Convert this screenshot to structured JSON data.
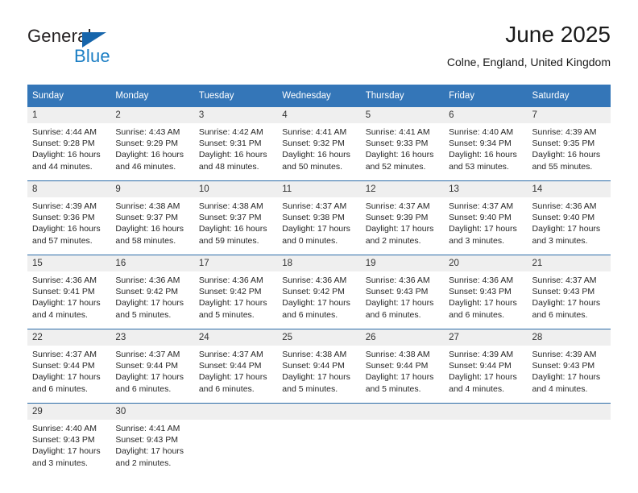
{
  "brand": {
    "name_part1": "General",
    "name_part2": "Blue",
    "triangle_icon": "blue-triangle-icon",
    "accent_color": "#1665ab",
    "blue_text_color": "#1b7ec4"
  },
  "header": {
    "title": "June 2025",
    "subtitle": "Colne, England, United Kingdom"
  },
  "calendar": {
    "header_bg": "#3476b8",
    "daynum_bg": "#efefef",
    "rule_color": "#2c6ca8",
    "weekday_headers": [
      "Sunday",
      "Monday",
      "Tuesday",
      "Wednesday",
      "Thursday",
      "Friday",
      "Saturday"
    ],
    "weeks": [
      [
        {
          "day": "1",
          "sunrise": "Sunrise: 4:44 AM",
          "sunset": "Sunset: 9:28 PM",
          "daylight1": "Daylight: 16 hours",
          "daylight2": "and 44 minutes."
        },
        {
          "day": "2",
          "sunrise": "Sunrise: 4:43 AM",
          "sunset": "Sunset: 9:29 PM",
          "daylight1": "Daylight: 16 hours",
          "daylight2": "and 46 minutes."
        },
        {
          "day": "3",
          "sunrise": "Sunrise: 4:42 AM",
          "sunset": "Sunset: 9:31 PM",
          "daylight1": "Daylight: 16 hours",
          "daylight2": "and 48 minutes."
        },
        {
          "day": "4",
          "sunrise": "Sunrise: 4:41 AM",
          "sunset": "Sunset: 9:32 PM",
          "daylight1": "Daylight: 16 hours",
          "daylight2": "and 50 minutes."
        },
        {
          "day": "5",
          "sunrise": "Sunrise: 4:41 AM",
          "sunset": "Sunset: 9:33 PM",
          "daylight1": "Daylight: 16 hours",
          "daylight2": "and 52 minutes."
        },
        {
          "day": "6",
          "sunrise": "Sunrise: 4:40 AM",
          "sunset": "Sunset: 9:34 PM",
          "daylight1": "Daylight: 16 hours",
          "daylight2": "and 53 minutes."
        },
        {
          "day": "7",
          "sunrise": "Sunrise: 4:39 AM",
          "sunset": "Sunset: 9:35 PM",
          "daylight1": "Daylight: 16 hours",
          "daylight2": "and 55 minutes."
        }
      ],
      [
        {
          "day": "8",
          "sunrise": "Sunrise: 4:39 AM",
          "sunset": "Sunset: 9:36 PM",
          "daylight1": "Daylight: 16 hours",
          "daylight2": "and 57 minutes."
        },
        {
          "day": "9",
          "sunrise": "Sunrise: 4:38 AM",
          "sunset": "Sunset: 9:37 PM",
          "daylight1": "Daylight: 16 hours",
          "daylight2": "and 58 minutes."
        },
        {
          "day": "10",
          "sunrise": "Sunrise: 4:38 AM",
          "sunset": "Sunset: 9:37 PM",
          "daylight1": "Daylight: 16 hours",
          "daylight2": "and 59 minutes."
        },
        {
          "day": "11",
          "sunrise": "Sunrise: 4:37 AM",
          "sunset": "Sunset: 9:38 PM",
          "daylight1": "Daylight: 17 hours",
          "daylight2": "and 0 minutes."
        },
        {
          "day": "12",
          "sunrise": "Sunrise: 4:37 AM",
          "sunset": "Sunset: 9:39 PM",
          "daylight1": "Daylight: 17 hours",
          "daylight2": "and 2 minutes."
        },
        {
          "day": "13",
          "sunrise": "Sunrise: 4:37 AM",
          "sunset": "Sunset: 9:40 PM",
          "daylight1": "Daylight: 17 hours",
          "daylight2": "and 3 minutes."
        },
        {
          "day": "14",
          "sunrise": "Sunrise: 4:36 AM",
          "sunset": "Sunset: 9:40 PM",
          "daylight1": "Daylight: 17 hours",
          "daylight2": "and 3 minutes."
        }
      ],
      [
        {
          "day": "15",
          "sunrise": "Sunrise: 4:36 AM",
          "sunset": "Sunset: 9:41 PM",
          "daylight1": "Daylight: 17 hours",
          "daylight2": "and 4 minutes."
        },
        {
          "day": "16",
          "sunrise": "Sunrise: 4:36 AM",
          "sunset": "Sunset: 9:42 PM",
          "daylight1": "Daylight: 17 hours",
          "daylight2": "and 5 minutes."
        },
        {
          "day": "17",
          "sunrise": "Sunrise: 4:36 AM",
          "sunset": "Sunset: 9:42 PM",
          "daylight1": "Daylight: 17 hours",
          "daylight2": "and 5 minutes."
        },
        {
          "day": "18",
          "sunrise": "Sunrise: 4:36 AM",
          "sunset": "Sunset: 9:42 PM",
          "daylight1": "Daylight: 17 hours",
          "daylight2": "and 6 minutes."
        },
        {
          "day": "19",
          "sunrise": "Sunrise: 4:36 AM",
          "sunset": "Sunset: 9:43 PM",
          "daylight1": "Daylight: 17 hours",
          "daylight2": "and 6 minutes."
        },
        {
          "day": "20",
          "sunrise": "Sunrise: 4:36 AM",
          "sunset": "Sunset: 9:43 PM",
          "daylight1": "Daylight: 17 hours",
          "daylight2": "and 6 minutes."
        },
        {
          "day": "21",
          "sunrise": "Sunrise: 4:37 AM",
          "sunset": "Sunset: 9:43 PM",
          "daylight1": "Daylight: 17 hours",
          "daylight2": "and 6 minutes."
        }
      ],
      [
        {
          "day": "22",
          "sunrise": "Sunrise: 4:37 AM",
          "sunset": "Sunset: 9:44 PM",
          "daylight1": "Daylight: 17 hours",
          "daylight2": "and 6 minutes."
        },
        {
          "day": "23",
          "sunrise": "Sunrise: 4:37 AM",
          "sunset": "Sunset: 9:44 PM",
          "daylight1": "Daylight: 17 hours",
          "daylight2": "and 6 minutes."
        },
        {
          "day": "24",
          "sunrise": "Sunrise: 4:37 AM",
          "sunset": "Sunset: 9:44 PM",
          "daylight1": "Daylight: 17 hours",
          "daylight2": "and 6 minutes."
        },
        {
          "day": "25",
          "sunrise": "Sunrise: 4:38 AM",
          "sunset": "Sunset: 9:44 PM",
          "daylight1": "Daylight: 17 hours",
          "daylight2": "and 5 minutes."
        },
        {
          "day": "26",
          "sunrise": "Sunrise: 4:38 AM",
          "sunset": "Sunset: 9:44 PM",
          "daylight1": "Daylight: 17 hours",
          "daylight2": "and 5 minutes."
        },
        {
          "day": "27",
          "sunrise": "Sunrise: 4:39 AM",
          "sunset": "Sunset: 9:44 PM",
          "daylight1": "Daylight: 17 hours",
          "daylight2": "and 4 minutes."
        },
        {
          "day": "28",
          "sunrise": "Sunrise: 4:39 AM",
          "sunset": "Sunset: 9:43 PM",
          "daylight1": "Daylight: 17 hours",
          "daylight2": "and 4 minutes."
        }
      ],
      [
        {
          "day": "29",
          "sunrise": "Sunrise: 4:40 AM",
          "sunset": "Sunset: 9:43 PM",
          "daylight1": "Daylight: 17 hours",
          "daylight2": "and 3 minutes."
        },
        {
          "day": "30",
          "sunrise": "Sunrise: 4:41 AM",
          "sunset": "Sunset: 9:43 PM",
          "daylight1": "Daylight: 17 hours",
          "daylight2": "and 2 minutes."
        },
        {
          "day": "",
          "sunrise": "",
          "sunset": "",
          "daylight1": "",
          "daylight2": ""
        },
        {
          "day": "",
          "sunrise": "",
          "sunset": "",
          "daylight1": "",
          "daylight2": ""
        },
        {
          "day": "",
          "sunrise": "",
          "sunset": "",
          "daylight1": "",
          "daylight2": ""
        },
        {
          "day": "",
          "sunrise": "",
          "sunset": "",
          "daylight1": "",
          "daylight2": ""
        },
        {
          "day": "",
          "sunrise": "",
          "sunset": "",
          "daylight1": "",
          "daylight2": ""
        }
      ]
    ]
  }
}
